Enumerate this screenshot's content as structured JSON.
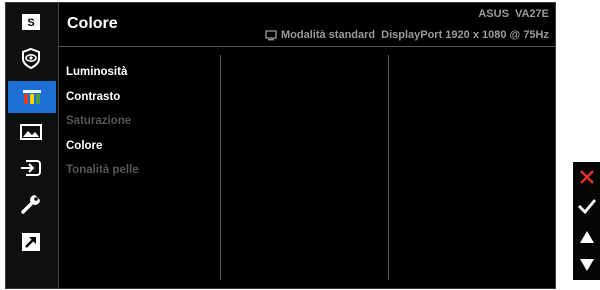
{
  "osd": {
    "title": "Colore",
    "model": "ASUS  VA27E",
    "mode": "Modalità standard",
    "input": "DisplayPort 1920 x 1080 @ 75Hz"
  },
  "sidebar": {
    "items": [
      {
        "name": "splendid-icon",
        "text": "S"
      },
      {
        "name": "blue-light-filter-icon"
      },
      {
        "name": "color-icon",
        "active": true
      },
      {
        "name": "image-icon"
      },
      {
        "name": "input-select-icon"
      },
      {
        "name": "system-setup-icon"
      },
      {
        "name": "shortcut-icon"
      }
    ]
  },
  "menu": {
    "items": [
      {
        "label": "Luminosità",
        "enabled": true
      },
      {
        "label": "Contrasto",
        "enabled": true
      },
      {
        "label": "Saturazione",
        "enabled": false
      },
      {
        "label": "Colore",
        "enabled": true
      },
      {
        "label": "Tonalità pelle",
        "enabled": false
      }
    ]
  },
  "controls": [
    "close-icon",
    "confirm-icon",
    "arrow-up-icon",
    "arrow-down-icon"
  ],
  "colors": {
    "accent": "#1d6fd6",
    "close": "#e03030",
    "text": "#ffffff",
    "disabled_text": "#555555",
    "status_text": "#9a9a9a"
  }
}
